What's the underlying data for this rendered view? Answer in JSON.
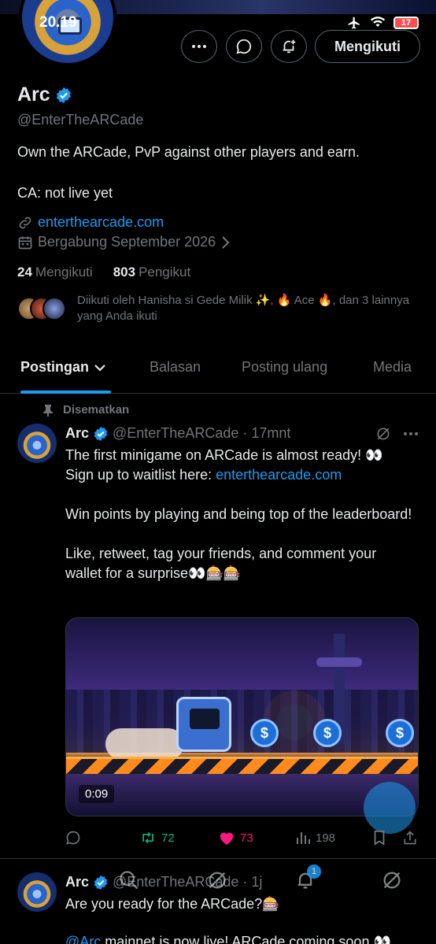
{
  "status_bar": {
    "time": "20.19",
    "battery": "17"
  },
  "header": {
    "follow_button": "Mengikuti"
  },
  "profile": {
    "name": "Arc",
    "handle": "@EnterTheARCade",
    "bio_line1": "Own the ARCade, PvP against other players and earn.",
    "bio_line2": "CA: not live yet",
    "website": "enterthearcade.com",
    "joined": "Bergabung September 2026",
    "following_count": "24",
    "following_label": "Mengikuti",
    "followers_count": "803",
    "followers_label": "Pengikut",
    "followed_by": "Diikuti oleh Hanisha si Gede Milik ✨, 🔥 Ace 🔥, dan 3 lainnya yang Anda ikuti"
  },
  "tabs": [
    {
      "label": "Postingan"
    },
    {
      "label": "Balasan"
    },
    {
      "label": "Posting ulang"
    },
    {
      "label": "Media"
    }
  ],
  "pinned_post": {
    "pinned_label": "Disematkan",
    "name": "Arc",
    "handle": "@EnterTheARCade",
    "time": "· 17mnt",
    "text_line1": "The first minigame on ARCade is almost ready! 👀",
    "text_line2_prefix": "Sign up to waitlist here: ",
    "text_line2_link": "enterthearcade.com",
    "paragraph2": "Win points by playing and being top of the leaderboard!",
    "paragraph3": "Like, retweet, tag your friends, and comment your wallet for a surprise👀🎰🎰",
    "video_duration": "0:09",
    "retweets": "72",
    "likes": "73",
    "views": "198"
  },
  "second_post": {
    "name": "Arc",
    "handle": "@EnterTheARCade",
    "time": "· 1j",
    "text": "Are you ready for the ARCade?🎰",
    "line2_mention": "@Arc",
    "line2_text": " mainnet is now live! ARCade coming soon 👀"
  },
  "nav": {
    "notification_count": "1"
  },
  "colors": {
    "accent": "#1d9bf0",
    "retweet": "#00ba7c",
    "like": "#f91880",
    "muted": "#71767b",
    "border": "#2f3336"
  }
}
